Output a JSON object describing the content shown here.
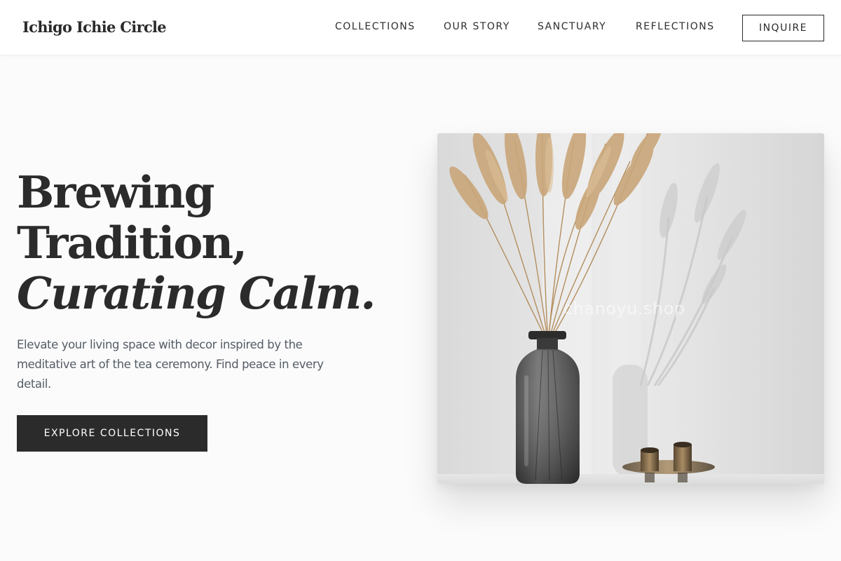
{
  "brand": {
    "name": "Ichigo Ichie Circle"
  },
  "nav": {
    "items": [
      {
        "label": "COLLECTIONS"
      },
      {
        "label": "OUR STORY"
      },
      {
        "label": "SANCTUARY"
      },
      {
        "label": "REFLECTIONS"
      }
    ],
    "cta_label": "INQUIRE"
  },
  "hero": {
    "title_line1": "Brewing",
    "title_line2": "Tradition,",
    "title_line3": "Curating Calm.",
    "description": "Elevate your living space with decor inspired by the meditative art of the tea ceremony. Find peace in every detail.",
    "button_label": "EXPLORE COLLECTIONS",
    "image_watermark": "chanoyu.shop"
  },
  "colors": {
    "background": "#fbfbfb",
    "header_background": "#ffffff",
    "text_primary": "#2b2b2b",
    "text_secondary": "#555c66",
    "button_dark": "#2b2b2b",
    "button_text": "#ffffff"
  },
  "icons": {
    "hero_image_subject": "pampas-grass-in-glass-vase-with-brass-candle-holders"
  }
}
